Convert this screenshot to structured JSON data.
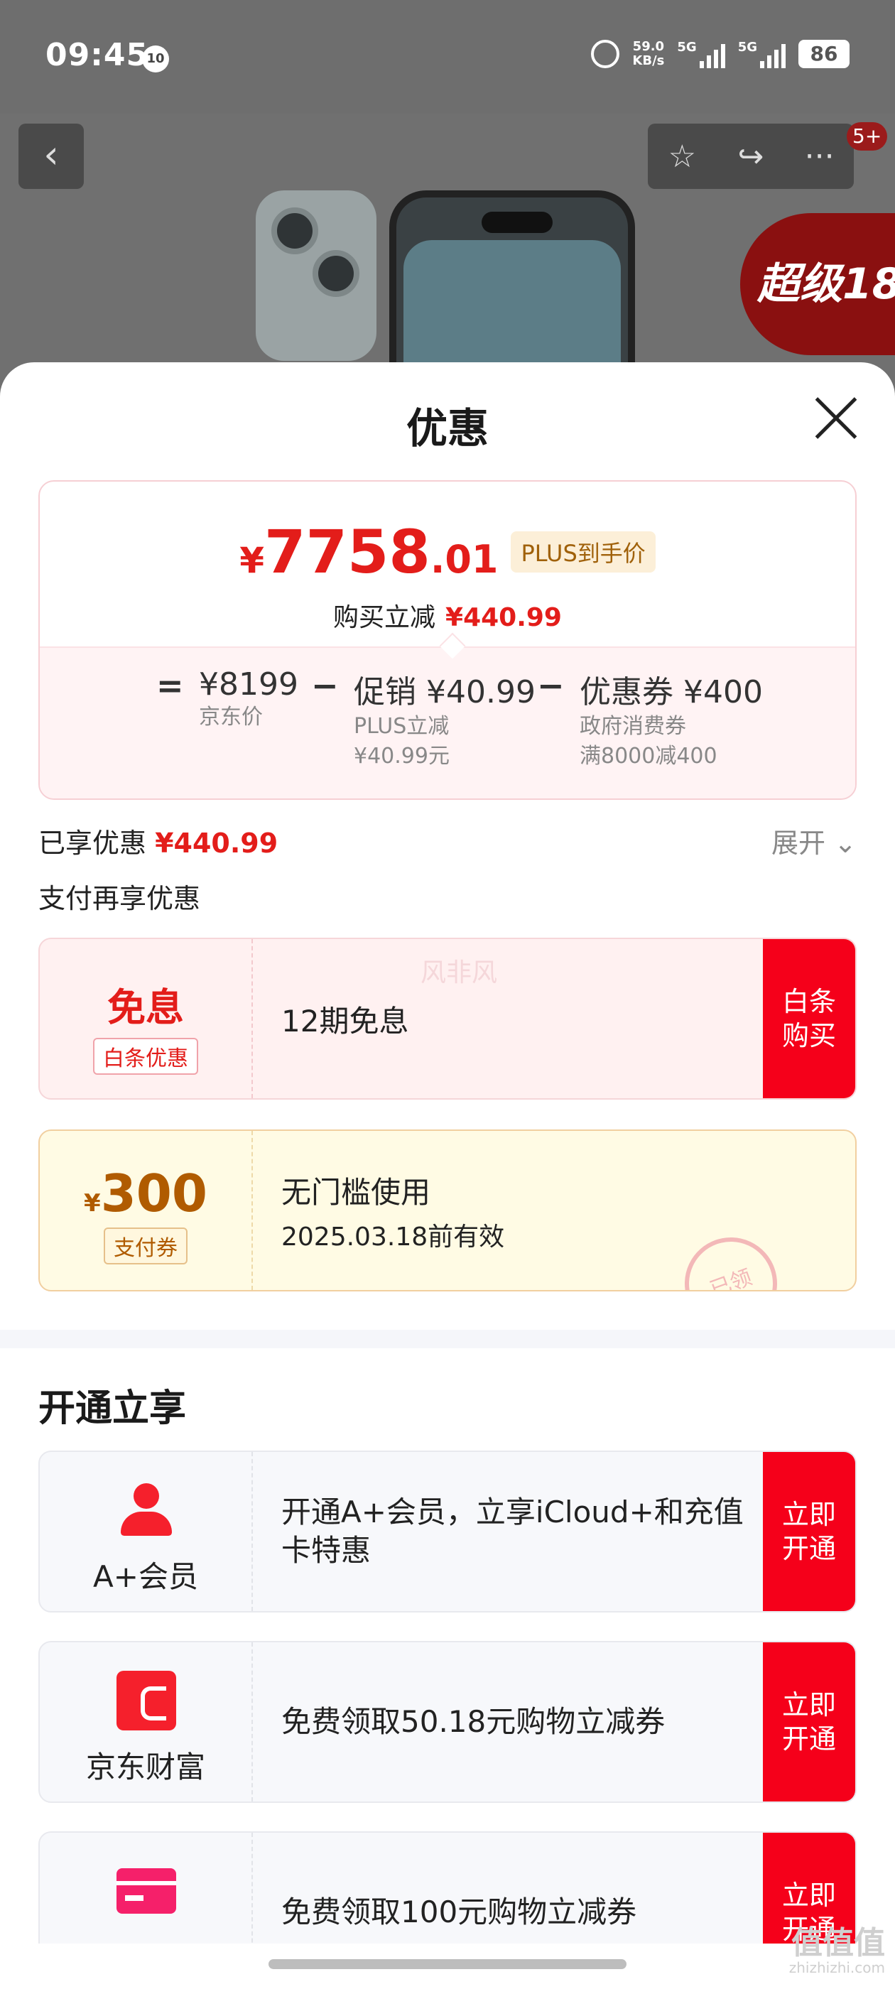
{
  "status": {
    "time": "09:45",
    "notif_badge": "10",
    "net_speed_top": "59.0",
    "net_speed_bottom": "KB/s",
    "sim1": "5G",
    "sim2": "5G",
    "battery": "86"
  },
  "topbar": {
    "back": "‹",
    "fav": "☆",
    "share": "↪",
    "more": "···",
    "badge": "5+",
    "promo": "超级18"
  },
  "sheet": {
    "title": "优惠",
    "close": "close"
  },
  "price": {
    "yen": "¥",
    "integer": "7758",
    "decimal": ".01",
    "tag": "PLUS到手价",
    "save_label": "购买立减",
    "save_value": "¥440.99"
  },
  "calc": {
    "eq": "=",
    "base_value": "¥8199",
    "base_label": "京东价",
    "minus1": "−",
    "promo_label": "促销",
    "promo_value": "¥40.99",
    "promo_sub1": "PLUS立减",
    "promo_sub2": "¥40.99元",
    "minus2": "−",
    "coupon_label": "优惠券",
    "coupon_value": "¥400",
    "coupon_sub1": "政府消费券",
    "coupon_sub2": "满8000减400"
  },
  "enjoyed": {
    "label": "已享优惠",
    "value": "¥440.99",
    "expand": "展开"
  },
  "pay_title": "支付再享优惠",
  "free_card": {
    "big": "免息",
    "tag": "白条优惠",
    "text": "12期免息",
    "watermark": "风非风",
    "btn_line1": "白条",
    "btn_line2": "购买"
  },
  "coupon_card": {
    "yen": "¥",
    "amount": "300",
    "tag": "支付券",
    "text": "无门槛使用",
    "sub": "2025.03.18前有效",
    "stamp": "已领"
  },
  "open_title": "开通立享",
  "members": [
    {
      "name": "A+会员",
      "icon": "user-icon",
      "text": "开通A+会员，立享iCloud+和充值卡特惠",
      "btn_line1": "立即",
      "btn_line2": "开通"
    },
    {
      "name": "京东财富",
      "icon": "wallet-icon",
      "text": "免费领取50.18元购物立减券",
      "btn_line1": "立即",
      "btn_line2": "开通"
    },
    {
      "name": "",
      "icon": "card-icon",
      "text": "免费领取100元购物立减券",
      "btn_line1": "立即",
      "btn_line2": "开通"
    }
  ],
  "corner_watermark": {
    "main": "值值值",
    "sub": "zhizhizhi.com"
  },
  "colors": {
    "accent": "#e31d1a",
    "button": "#f5001a",
    "gold": "#b05b00"
  }
}
